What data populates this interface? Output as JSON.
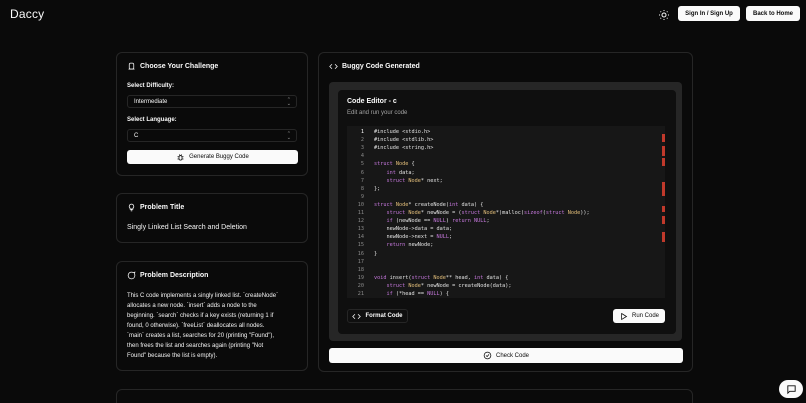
{
  "header": {
    "brand": "Daccy",
    "theme_icon": "sun-icon",
    "signin_label": "Sign In / Sign Up",
    "home_label": "Back to Home"
  },
  "challenge": {
    "title": "Choose Your Challenge",
    "difficulty_label": "Select Difficulty:",
    "difficulty_value": "Intermediate",
    "language_label": "Select Language:",
    "language_value": "C",
    "generate_label": "Generate Buggy Code"
  },
  "problem": {
    "heading": "Problem Title",
    "title": "Singly Linked List Search and Deletion"
  },
  "description": {
    "heading": "Problem Description",
    "lines": [
      "This C code implements a singly linked list. `createNode`",
      "allocates a new node. `insert` adds a node to the",
      "beginning. `search` checks if a key exists (returning 1 if",
      "found, 0 otherwise). `freeList` deallocates all nodes.",
      "`main` creates a list, searches for 20 (printing \"Found\"),",
      "then frees the list and searches again (printing \"Not",
      "Found\" because the list is empty)."
    ]
  },
  "code_panel": {
    "heading": "Buggy Code Generated",
    "editor_title": "Code Editor - c",
    "editor_subtitle": "Edit and run your code",
    "line_numbers": [
      "1",
      "2",
      "3",
      "4",
      "5",
      "6",
      "7",
      "8",
      "9",
      "10",
      "11",
      "12",
      "13",
      "14",
      "15",
      "16",
      "17",
      "18",
      "19",
      "20",
      "21"
    ],
    "lines": [
      "#include <stdio.h>",
      "#include <stdlib.h>",
      "#include <string.h>",
      "",
      "struct Node {",
      "    int data;",
      "    struct Node* next;",
      "};",
      "",
      "struct Node* createNode(int data) {",
      "    struct Node* newNode = (struct Node*)malloc(sizeof(struct Node));",
      "    if (newNode == NULL) return NULL;",
      "    newNode->data = data;",
      "    newNode->next = NULL;",
      "    return newNode;",
      "}",
      "",
      "",
      "void insert(struct Node** head, int data) {",
      "    struct Node* newNode = createNode(data);",
      "    if (*head == NULL) {"
    ],
    "format_label": "Format Code",
    "run_label": "Run Code",
    "check_label": "Check Code"
  },
  "colors": {
    "background": "#0a0a0a",
    "card_border": "#262626",
    "button_light": "#fafafa",
    "error_marker": "#c0392b"
  }
}
